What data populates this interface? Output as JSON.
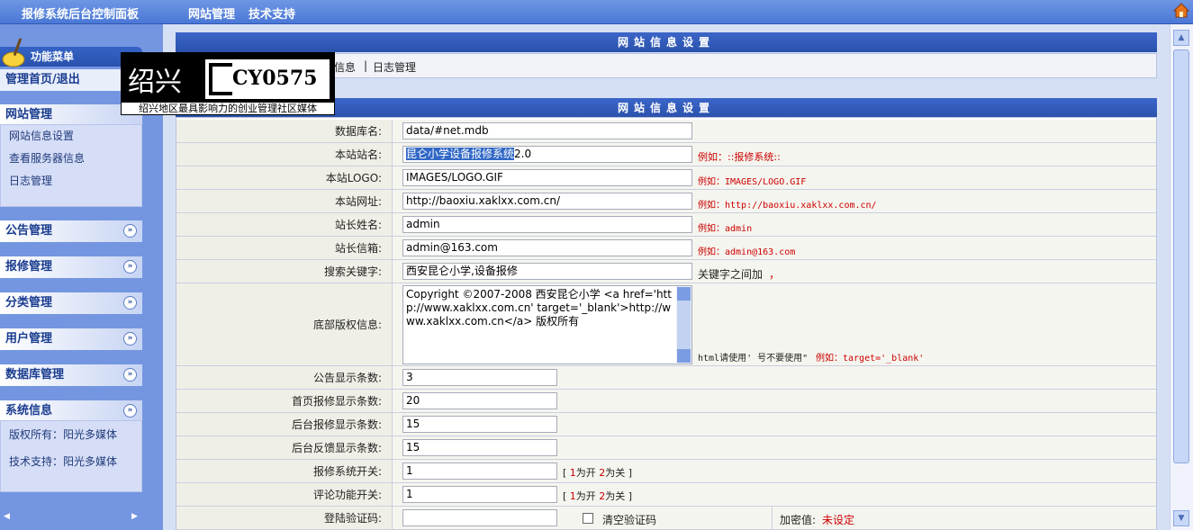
{
  "topbar": {
    "brand": "报修系统后台控制面板",
    "nav": [
      "网站管理",
      "技术支持"
    ]
  },
  "sidebar": {
    "menu_head": "功能菜单",
    "home_link": "管理首页/退出",
    "site_section": {
      "title": "网站管理",
      "items": [
        "网站信息设置",
        "查看服务器信息",
        "日志管理"
      ]
    },
    "collapsed_sections": [
      "公告管理",
      "报修管理",
      "分类管理",
      "用户管理",
      "数据库管理"
    ],
    "system_section": {
      "title": "系统信息",
      "items": [
        "版权所有：阳光多媒体",
        "技术支持：阳光多媒体"
      ]
    }
  },
  "logo": {
    "city": "绍兴",
    "brand": "CY0575",
    "slogan": "绍兴地区最具影响力的创业管理社区媒体"
  },
  "main": {
    "panel_title": "网站信息设置",
    "tabs": [
      "信息",
      "|",
      "日志管理"
    ],
    "form_title": "网站信息设置",
    "fields": {
      "db_name": {
        "label": "数据库名:",
        "value": "data/#net.mdb"
      },
      "site_name": {
        "label": "本站站名:",
        "value_selected": "昆仑小学设备报修系统",
        "value_rest": "2.0",
        "hint": "例如：::报修系统::"
      },
      "site_logo": {
        "label": "本站LOGO:",
        "value": "IMAGES/LOGO.GIF",
        "hint": "例如：IMAGES/LOGO.GIF"
      },
      "site_url": {
        "label": "本站网址:",
        "value": "http://baoxiu.xaklxx.com.cn/",
        "hint": "例如：http://baoxiu.xaklxx.com.cn/"
      },
      "admin_name": {
        "label": "站长姓名:",
        "value": "admin",
        "hint": "例如：admin"
      },
      "admin_email": {
        "label": "站长信箱:",
        "value": "admin@163.com",
        "hint": "例如：admin@163.com"
      },
      "keywords": {
        "label": "搜索关键字:",
        "value": "西安昆仑小学,设备报修",
        "hint_plain": "关键字之间加",
        "hint_red": "，"
      },
      "copyright": {
        "label": "底部版权信息:",
        "value": "Copyright ©2007-2008 西安昆仑小学  <a href='http://www.xaklxx.com.cn' target='_blank'>http://www.xaklxx.com.cn</a> 版权所有",
        "hint_plain": "html请使用' 号不要使用\"",
        "hint_red": "例如：target='_blank'"
      },
      "notice_count": {
        "label": "公告显示条数:",
        "value": "3"
      },
      "home_repair_count": {
        "label": "首页报修显示条数:",
        "value": "20"
      },
      "admin_repair_count": {
        "label": "后台报修显示条数:",
        "value": "15"
      },
      "admin_feedback_count": {
        "label": "后台反馈显示条数:",
        "value": "15"
      },
      "repair_switch": {
        "label": "报修系统开关:",
        "value": "1",
        "hint_open": "1",
        "hint_open_text": "为开",
        "hint_close": "2",
        "hint_close_text": "为关"
      },
      "comment_switch": {
        "label": "评论功能开关:",
        "value": "1",
        "hint_open": "1",
        "hint_open_text": "为开",
        "hint_close": "2",
        "hint_close_text": "为关"
      },
      "login_code": {
        "label": "登陆验证码:",
        "value": "",
        "checkbox_label": "清空验证码",
        "encrypt_label": "加密值:",
        "encrypt_value": "未设定"
      }
    }
  }
}
